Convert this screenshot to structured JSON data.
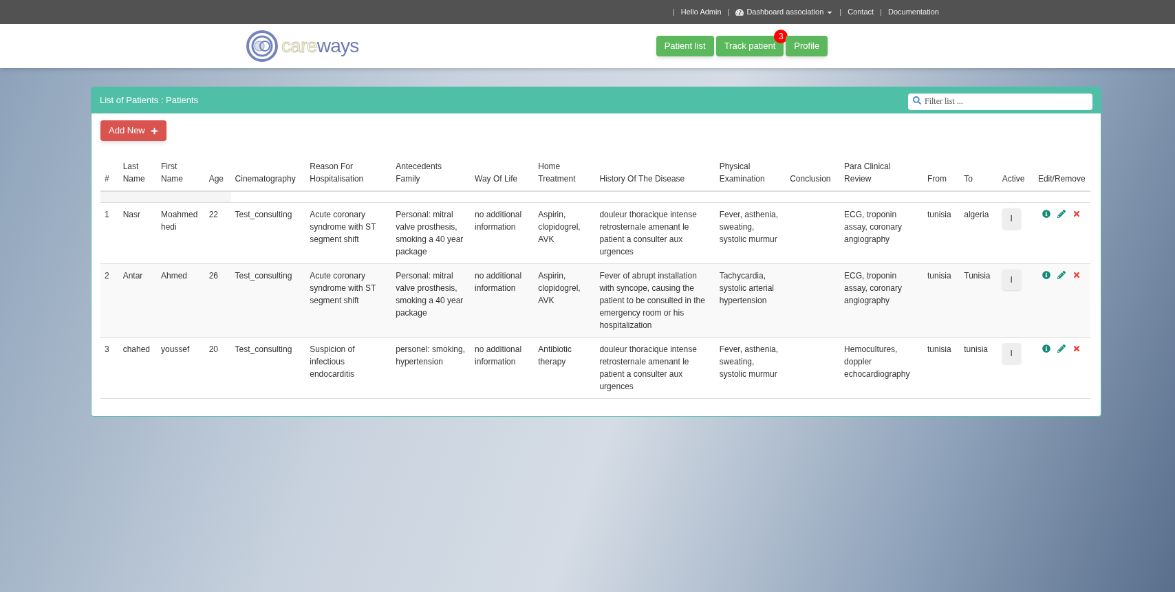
{
  "topbar": {
    "links": [
      {
        "kind": "separator",
        "label": "|"
      },
      {
        "kind": "text",
        "label": "Hello Admin"
      },
      {
        "kind": "separator",
        "label": "|"
      },
      {
        "kind": "dropdown",
        "label": "Dashboard association"
      },
      {
        "kind": "separator",
        "label": "|"
      },
      {
        "kind": "link",
        "label": "Contact"
      },
      {
        "kind": "separator",
        "label": "|"
      },
      {
        "kind": "link",
        "label": "Documentation"
      }
    ]
  },
  "header": {
    "logo": {
      "part_a": "care",
      "part_b": "ways"
    },
    "nav": [
      {
        "label": "Patient list"
      },
      {
        "label": "Track patient",
        "badge": "3"
      },
      {
        "label": "Profile"
      }
    ]
  },
  "panel": {
    "title": "List of Patients : Patients",
    "filter": {
      "placeholder": "Filter list ..."
    },
    "add_button": "Add New",
    "table": {
      "columns": [
        "#",
        "Last Name",
        "First Name",
        "Age",
        "Cinematography",
        "Reason For Hospitalisation",
        "Antecedents Family",
        "Way Of Life",
        "Home Treatment",
        "History Of The Disease",
        "Physical Examination",
        "Conclusion",
        "Para Clinical Review",
        "From",
        "To",
        "Active",
        "Edit/Remove"
      ],
      "rows": [
        {
          "cells": [
            "1",
            "Nasr",
            "Moahmed hedi",
            "22",
            "Test_consulting",
            "Acute coronary syndrome with ST segment shift",
            "Personal: mitral valve prosthesis, smoking a 40 year package",
            "no additional information",
            "Aspirin, clopidogrel, AVK",
            "douleur thoracique intense retrosternale amenant le patient a consulter aux urgences",
            "Fever, asthenia, sweating, systolic murmur",
            "",
            "ECG, troponin assay, coronary angiography",
            "tunisia",
            "algeria"
          ],
          "active": "I"
        },
        {
          "cells": [
            "2",
            "Antar",
            "Ahmed",
            "26",
            "Test_consulting",
            "Acute coronary syndrome with ST segment shift",
            "Personal: mitral valve prosthesis, smoking a 40 year package",
            "no additional information",
            "Aspirin, clopidogrel, AVK",
            "Fever of abrupt installation with syncope, causing the patient to be consulted in the emergency room or his hospitalization",
            "Tachycardia, systolic arterial hypertension",
            "",
            "ECG, troponin assay, coronary angiography",
            "tunisia",
            "Tunisia"
          ],
          "active": "I"
        },
        {
          "cells": [
            "3",
            "chahed",
            "youssef",
            "20",
            "Test_consulting",
            "Suspicion of infectious endocarditis",
            "personel: smoking, hypertension",
            "no additional information",
            "Antibiotic therapy",
            "douleur thoracique intense retrosternale amenant le patient a consulter aux urgences",
            "Fever, asthenia, sweating, systolic murmur",
            "",
            "Hemocultures, doppler echocardiography",
            "tunisia",
            "tunisia"
          ],
          "active": "I"
        }
      ]
    }
  }
}
